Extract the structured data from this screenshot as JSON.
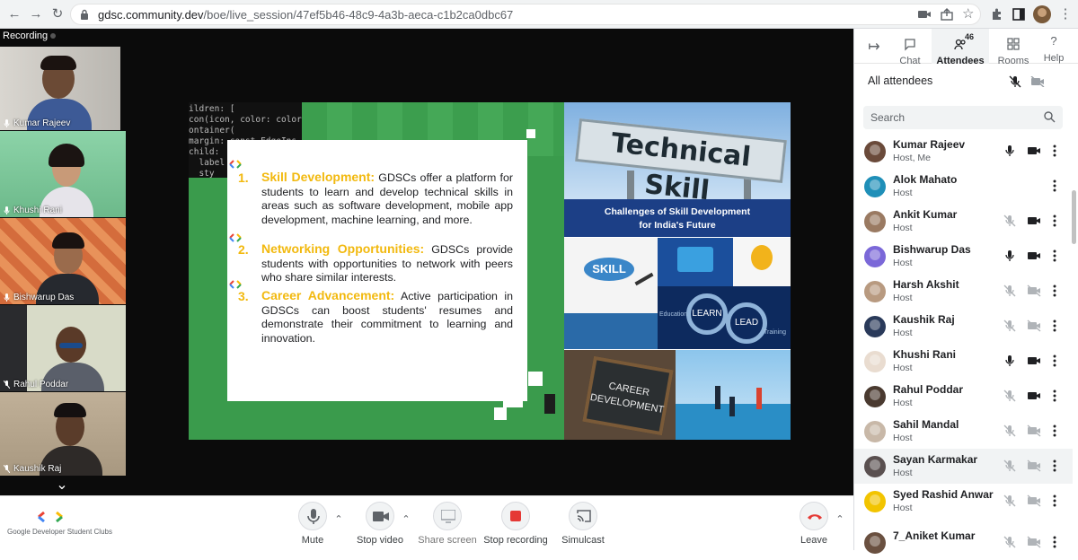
{
  "browser": {
    "url_host": "gdsc.community.dev",
    "url_path": "/boe/live_session/47ef5b46-48c9-4a3b-aeca-c1b2ca0dbc67"
  },
  "stage": {
    "recording_label": "Recording",
    "tiles": [
      {
        "name": "Kumar Rajeev",
        "mic": "on"
      },
      {
        "name": "Khushi Rani",
        "mic": "on"
      },
      {
        "name": "Bishwarup Das",
        "mic": "on"
      },
      {
        "name": "Rahul Poddar",
        "mic": "muted"
      },
      {
        "name": "Kaushik Raj",
        "mic": "muted"
      }
    ]
  },
  "slide": {
    "code_lines": [
      "ildren: [",
      "con(icon, color: color",
      "ontainer(",
      "margin: const EdgeIns",
      "child: ",
      "  label",
      "  sty"
    ],
    "points": [
      {
        "num": "1.",
        "heading": "Skill Development:",
        "text": " GDSCs offer a platform for students to learn and develop technical skills in areas such as software development, mobile app development, machine learning, and more."
      },
      {
        "num": "2.",
        "heading": "Networking Opportunities:",
        "text": " GDSCs provide students with opportunities to network with peers who share similar interests."
      },
      {
        "num": "3.",
        "heading": "Career Advancement:",
        "text": " Active participation in GDSCs can boost students' resumes and demonstrate their commitment to learning and innovation."
      }
    ],
    "sign_text": "Technical Skill",
    "banner_line1": "Challenges of Skill Development",
    "banner_line2": "for India's Future",
    "skill_word": "SKILL",
    "learn_word": "LEARN",
    "lead_word": "LEAD",
    "education_word": "Education",
    "training_word": "Training",
    "career_line1": "CAREER",
    "career_line2": "DEVELOPMENT"
  },
  "toolbar": {
    "mute": "Mute",
    "stop_video": "Stop video",
    "share_screen": "Share screen",
    "stop_recording": "Stop recording",
    "simulcast": "Simulcast",
    "leave": "Leave",
    "logo_text": "Google Developer Student Clubs"
  },
  "panel": {
    "tabs": [
      {
        "label": "Chat",
        "icon": "chat-bubble-icon"
      },
      {
        "label": "Attendees",
        "icon": "people-icon",
        "count": "46",
        "active": true
      },
      {
        "label": "Rooms",
        "icon": "grid-icon"
      },
      {
        "label": "Help",
        "icon": "help-icon"
      }
    ],
    "collapse_icon": "collapse-arrow-icon",
    "all_attendees": "All attendees",
    "search_placeholder": "Search",
    "attendees": [
      {
        "name": "Kumar Rajeev",
        "role": "Host, Me",
        "mic": "on",
        "cam": "on",
        "avatar": "#6a4a3a"
      },
      {
        "name": "Alok Mahato",
        "role": "Host",
        "mic": "none",
        "cam": "none",
        "avatar": "#1f8fb8"
      },
      {
        "name": "Ankit Kumar",
        "role": "Host",
        "mic": "off",
        "cam": "on",
        "avatar": "#9a7a62"
      },
      {
        "name": "Bishwarup Das",
        "role": "Host",
        "mic": "on",
        "cam": "on",
        "avatar": "#7b68d8"
      },
      {
        "name": "Harsh Akshit",
        "role": "Host",
        "mic": "off",
        "cam": "off",
        "avatar": "#b89a80"
      },
      {
        "name": "Kaushik Raj",
        "role": "Host",
        "mic": "off",
        "cam": "off",
        "avatar": "#2a3a5a"
      },
      {
        "name": "Khushi Rani",
        "role": "Host",
        "mic": "on",
        "cam": "on",
        "avatar": "#e9dcd0"
      },
      {
        "name": "Rahul Poddar",
        "role": "Host",
        "mic": "off",
        "cam": "on",
        "avatar": "#4a3a30"
      },
      {
        "name": "Sahil Mandal",
        "role": "Host",
        "mic": "off",
        "cam": "off",
        "avatar": "#c8b8a8"
      },
      {
        "name": "Sayan Karmakar",
        "role": "Host",
        "mic": "off",
        "cam": "off",
        "avatar": "#5a5050"
      },
      {
        "name": "Syed Rashid Anwar",
        "role": "Host",
        "mic": "off",
        "cam": "off",
        "avatar": "#f2c400"
      },
      {
        "name": "7_Aniket Kumar",
        "role": "",
        "mic": "off",
        "cam": "off",
        "avatar": "#6a5040"
      }
    ]
  }
}
